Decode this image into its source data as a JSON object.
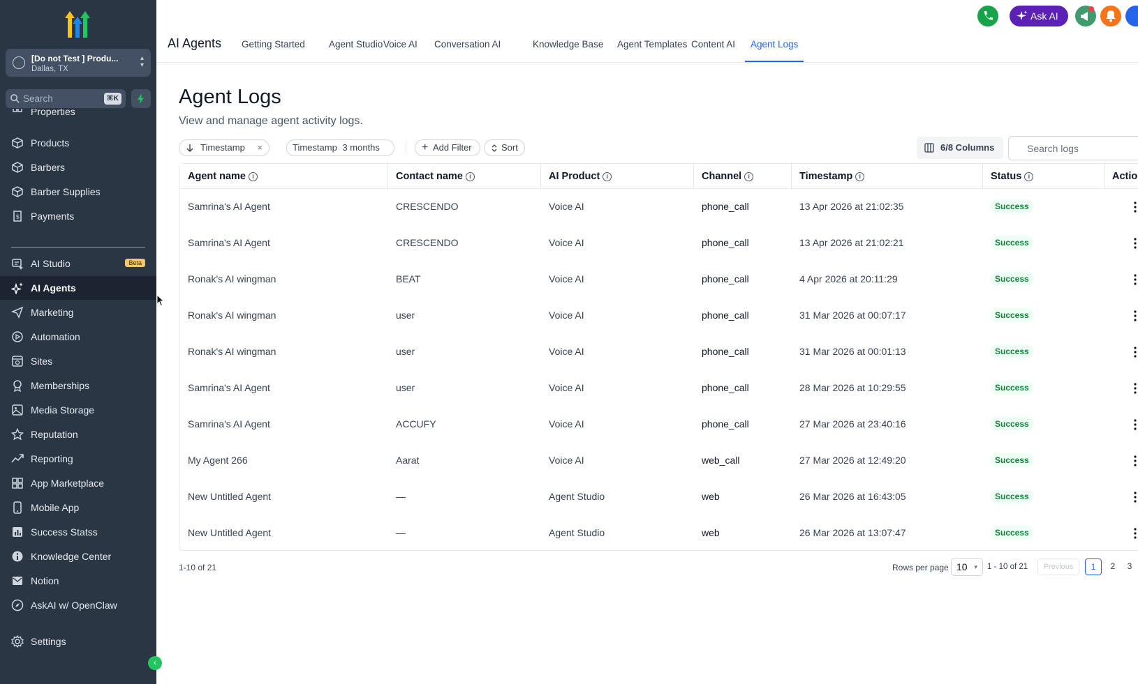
{
  "sidebar": {
    "account": {
      "name": "[Do not Test ] Produ...",
      "location": "Dallas, TX"
    },
    "search": {
      "placeholder": "Search",
      "shortcut": "⌘K"
    },
    "items": [
      {
        "label": "Properties",
        "icon": "grid-icon"
      },
      {
        "label": "Products",
        "icon": "cube-icon"
      },
      {
        "label": "Barbers",
        "icon": "cube-icon"
      },
      {
        "label": "Barber Supplies",
        "icon": "cube-icon"
      },
      {
        "label": "Payments",
        "icon": "receipt-icon"
      },
      {
        "label": "AI Studio",
        "icon": "ai-studio-icon",
        "badge": "Beta"
      },
      {
        "label": "AI Agents",
        "icon": "sparkle-icon",
        "active": true
      },
      {
        "label": "Marketing",
        "icon": "send-icon"
      },
      {
        "label": "Automation",
        "icon": "automation-icon"
      },
      {
        "label": "Sites",
        "icon": "sites-icon"
      },
      {
        "label": "Memberships",
        "icon": "award-icon"
      },
      {
        "label": "Media Storage",
        "icon": "image-icon"
      },
      {
        "label": "Reputation",
        "icon": "star-icon"
      },
      {
        "label": "Reporting",
        "icon": "trend-icon"
      },
      {
        "label": "App Marketplace",
        "icon": "apps-icon"
      },
      {
        "label": "Mobile App",
        "icon": "phone-icon"
      },
      {
        "label": "Success Statss",
        "icon": "chart-icon"
      },
      {
        "label": "Knowledge Center",
        "icon": "info-icon"
      },
      {
        "label": "Notion",
        "icon": "mail-icon"
      },
      {
        "label": "AskAI w/ OpenClaw",
        "icon": "compass-icon"
      },
      {
        "label": "Settings",
        "icon": "gear-icon"
      }
    ]
  },
  "header": {
    "app_title": "AI Agents",
    "tabs": [
      {
        "label": "Getting Started"
      },
      {
        "label": "Agent Studio"
      },
      {
        "label": "Voice AI"
      },
      {
        "label": "Conversation AI"
      },
      {
        "label": "Knowledge Base"
      },
      {
        "label": "Agent Templates"
      },
      {
        "label": "Content AI"
      },
      {
        "label": "Agent Logs",
        "active": true
      }
    ],
    "ask_ai_label": "Ask AI"
  },
  "page": {
    "title": "Agent Logs",
    "subtitle": "View and manage agent activity logs."
  },
  "filters": {
    "sort_chip": "Timestamp",
    "range_chip_label": "Timestamp",
    "range_chip_value": "3 months",
    "add_filter": "Add Filter",
    "sort": "Sort",
    "columns": "6/8 Columns",
    "search_placeholder": "Search logs"
  },
  "table": {
    "columns": [
      "Agent name",
      "Contact name",
      "AI Product",
      "Channel",
      "Timestamp",
      "Status",
      "Actions"
    ],
    "rows": [
      {
        "agent": "Samrina's AI Agent",
        "contact": "CRESCENDO",
        "product": "Voice AI",
        "channel": "phone_call",
        "timestamp": "13 Apr 2026 at 21:02:35",
        "status": "Success"
      },
      {
        "agent": "Samrina's AI Agent",
        "contact": "CRESCENDO",
        "product": "Voice AI",
        "channel": "phone_call",
        "timestamp": "13 Apr 2026 at 21:02:21",
        "status": "Success"
      },
      {
        "agent": "Ronak's AI wingman",
        "contact": "BEAT",
        "product": "Voice AI",
        "channel": "phone_call",
        "timestamp": "4 Apr 2026 at 20:11:29",
        "status": "Success"
      },
      {
        "agent": "Ronak's AI wingman",
        "contact": "user",
        "product": "Voice AI",
        "channel": "phone_call",
        "timestamp": "31 Mar 2026 at 00:07:17",
        "status": "Success"
      },
      {
        "agent": "Ronak's AI wingman",
        "contact": "user",
        "product": "Voice AI",
        "channel": "phone_call",
        "timestamp": "31 Mar 2026 at 00:01:13",
        "status": "Success"
      },
      {
        "agent": "Samrina's AI Agent",
        "contact": "user",
        "product": "Voice AI",
        "channel": "phone_call",
        "timestamp": "28 Mar 2026 at 10:29:55",
        "status": "Success"
      },
      {
        "agent": "Samrina's AI Agent",
        "contact": "ACCUFY",
        "product": "Voice AI",
        "channel": "phone_call",
        "timestamp": "27 Mar 2026 at 23:40:16",
        "status": "Success"
      },
      {
        "agent": "My Agent 266",
        "contact": "Aarat",
        "product": "Voice AI",
        "channel": "web_call",
        "timestamp": "27 Mar 2026 at 12:49:20",
        "status": "Success"
      },
      {
        "agent": "New Untitled Agent",
        "contact": "—",
        "product": "Agent Studio",
        "channel": "web",
        "timestamp": "26 Mar 2026 at 16:43:05",
        "status": "Success"
      },
      {
        "agent": "New Untitled Agent",
        "contact": "—",
        "product": "Agent Studio",
        "channel": "web",
        "timestamp": "26 Mar 2026 at 13:07:47",
        "status": "Success"
      }
    ]
  },
  "pagination": {
    "count": "1-10 of 21",
    "rows_per_page_label": "Rows per page",
    "rows_per_page": "10",
    "range": "1 - 10 of 21",
    "previous": "Previous",
    "pages": [
      "1",
      "2",
      "3"
    ],
    "current_page": "1"
  },
  "colors": {
    "sidebar_bg": "#2b3645",
    "accent": "#2563eb",
    "ask_ai": "#5b21b6",
    "success_text": "#15803d",
    "success_bg": "#ecfdf3",
    "phone_button": "#16a34a",
    "notification": "#f97316"
  }
}
